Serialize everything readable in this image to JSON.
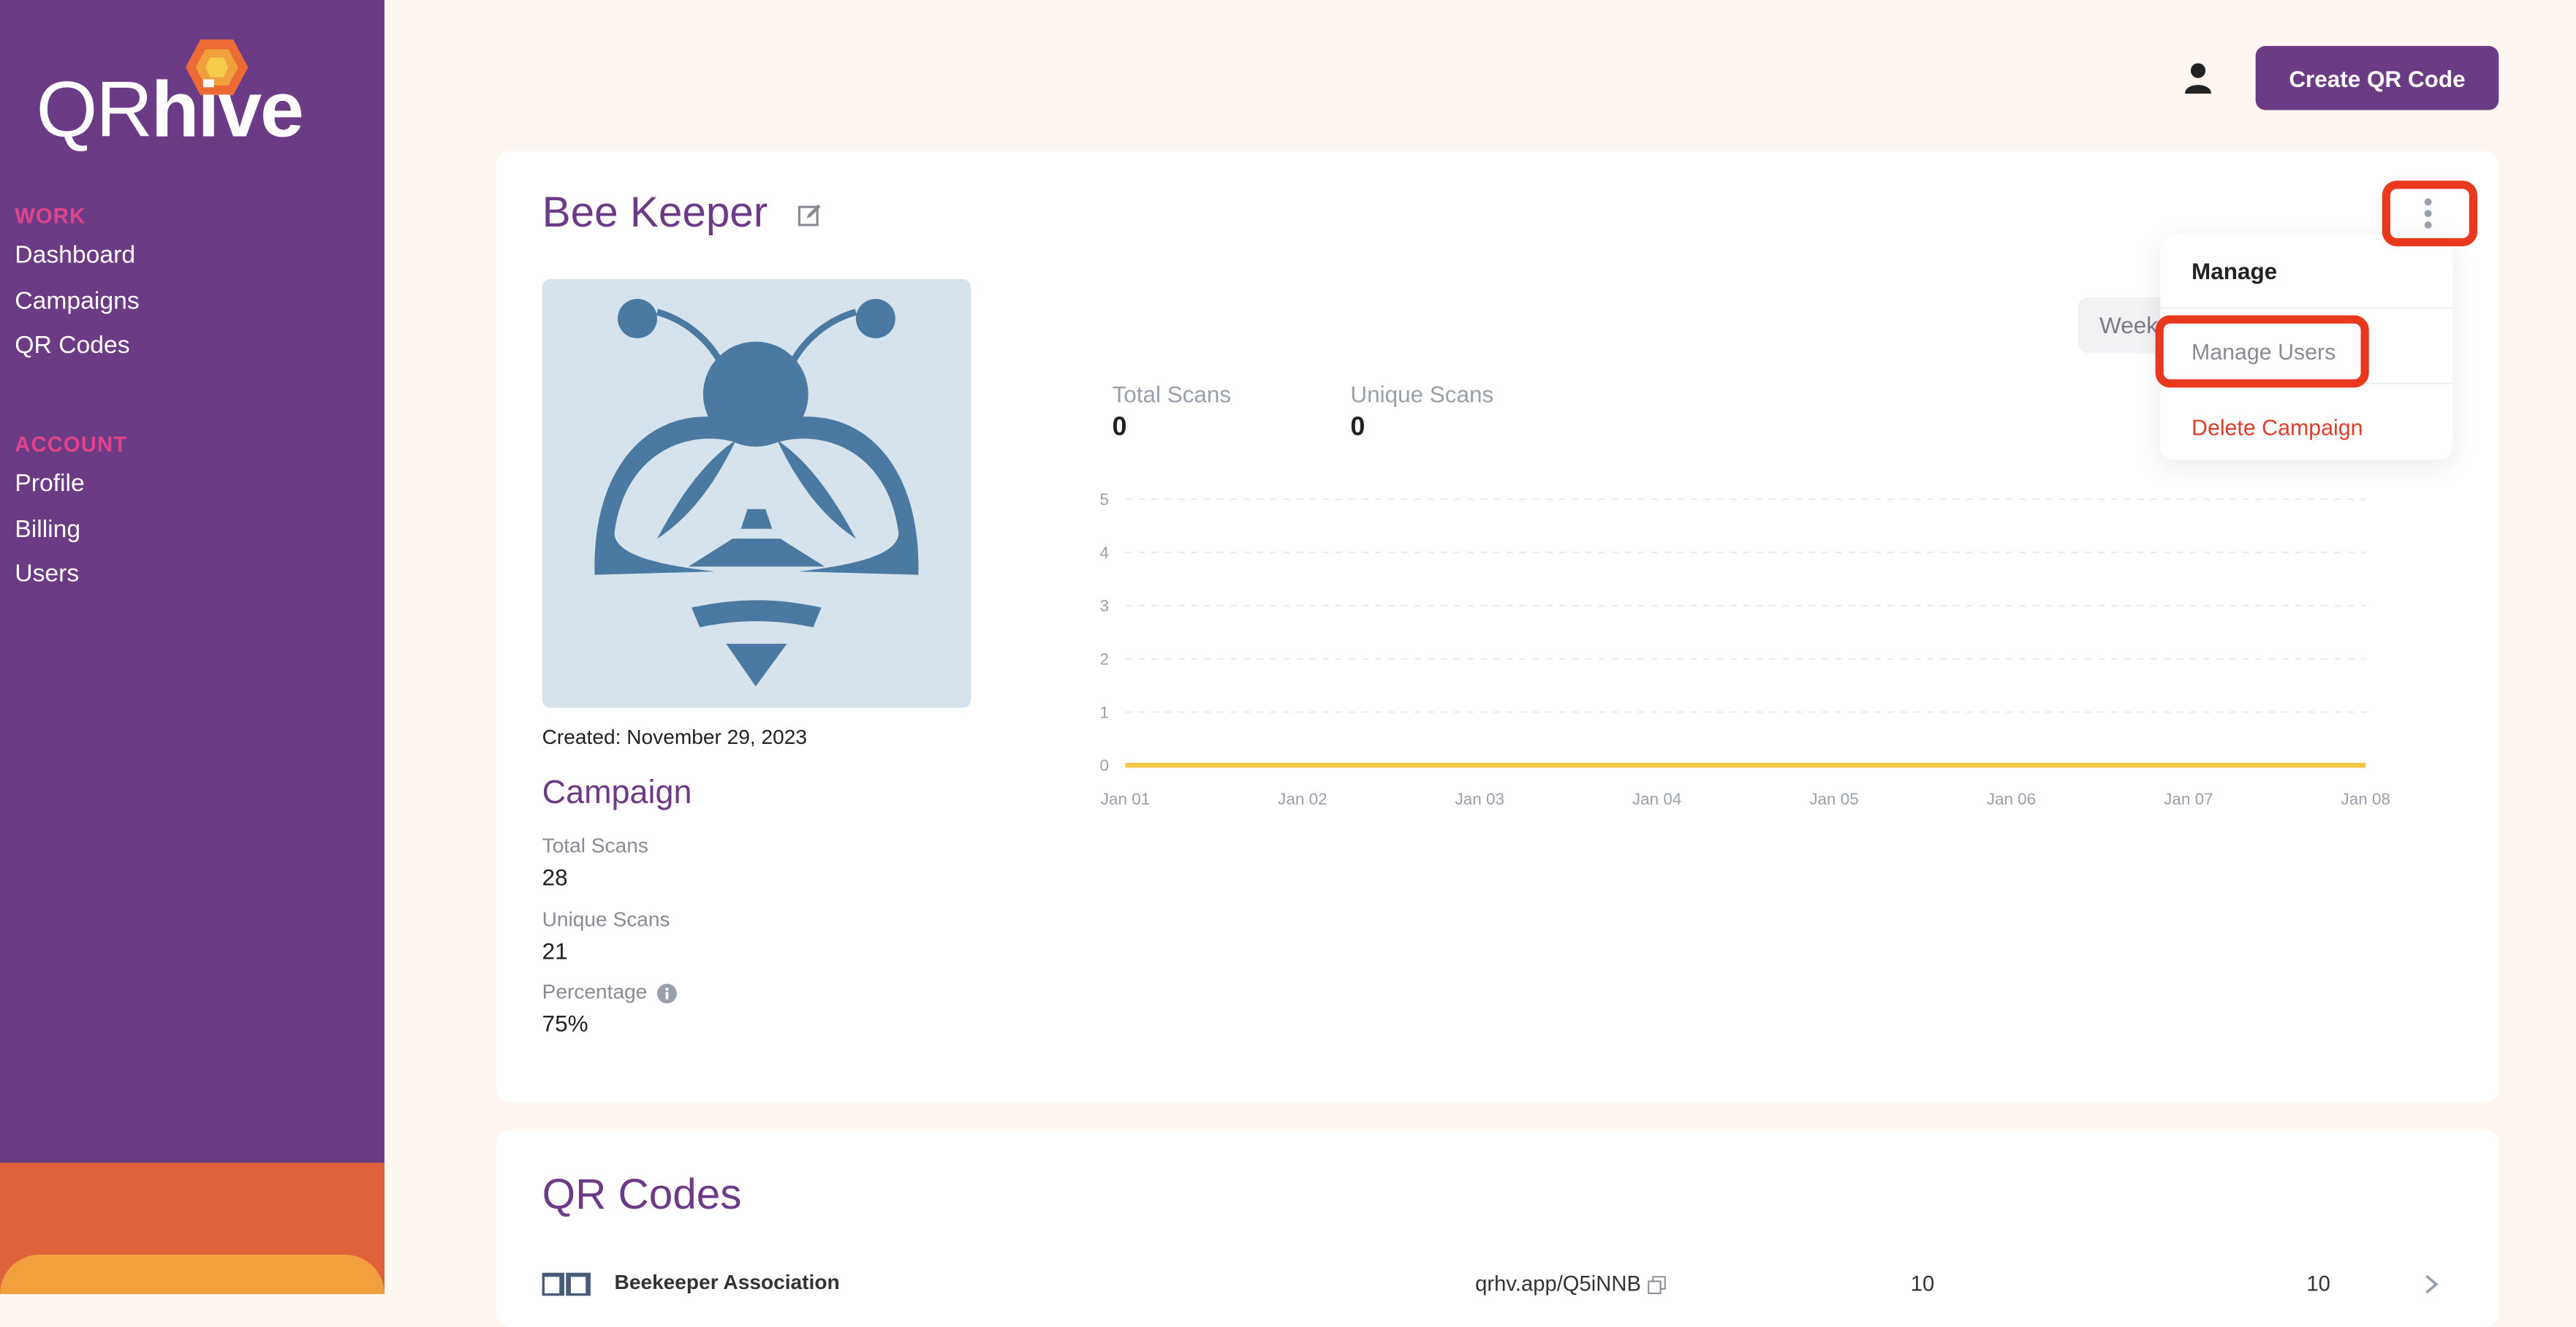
{
  "brand": {
    "name_light": "QR",
    "name_bold": "hive"
  },
  "sidebar": {
    "work_heading": "WORK",
    "work_items": [
      {
        "label": "Dashboard"
      },
      {
        "label": "Campaigns"
      },
      {
        "label": "QR Codes"
      }
    ],
    "account_heading": "ACCOUNT",
    "account_items": [
      {
        "label": "Profile"
      },
      {
        "label": "Billing"
      },
      {
        "label": "Users"
      }
    ]
  },
  "header": {
    "create_label": "Create QR Code"
  },
  "campaign": {
    "title": "Bee Keeper",
    "created_label": "Created:",
    "created_date": "November 29, 2023",
    "section_title": "Campaign",
    "stats": [
      {
        "label": "Total Scans",
        "value": "28"
      },
      {
        "label": "Unique Scans",
        "value": "21"
      },
      {
        "label": "Percentage",
        "value": "75%"
      }
    ],
    "range_button": "Week",
    "chart_summary": [
      {
        "label": "Total Scans",
        "value": "0"
      },
      {
        "label": "Unique Scans",
        "value": "0"
      }
    ]
  },
  "menu": {
    "heading": "Manage",
    "manage_users": "Manage Users",
    "delete_campaign": "Delete Campaign"
  },
  "qr_codes": {
    "title": "QR Codes",
    "rows": [
      {
        "name": "Beekeeper Association",
        "link": "qrhv.app/Q5iNNB",
        "scans": "10",
        "unique": "10"
      }
    ]
  },
  "colors": {
    "brand_purple": "#6c3b85",
    "accent_pink": "#e0438a",
    "danger_red": "#e03c2a",
    "line_yellow": "#f3c643",
    "highlight_red": "#e8391f"
  },
  "chart_data": {
    "type": "line",
    "x": [
      "Jan 01",
      "Jan 02",
      "Jan 03",
      "Jan 04",
      "Jan 05",
      "Jan 06",
      "Jan 07",
      "Jan 08"
    ],
    "series": [
      {
        "values": [
          0,
          0,
          0,
          0,
          0,
          0,
          0,
          0
        ]
      }
    ],
    "ylim": [
      0,
      5
    ],
    "yticks": [
      "0",
      "1",
      "2",
      "3",
      "4",
      "5"
    ],
    "grid": true
  }
}
